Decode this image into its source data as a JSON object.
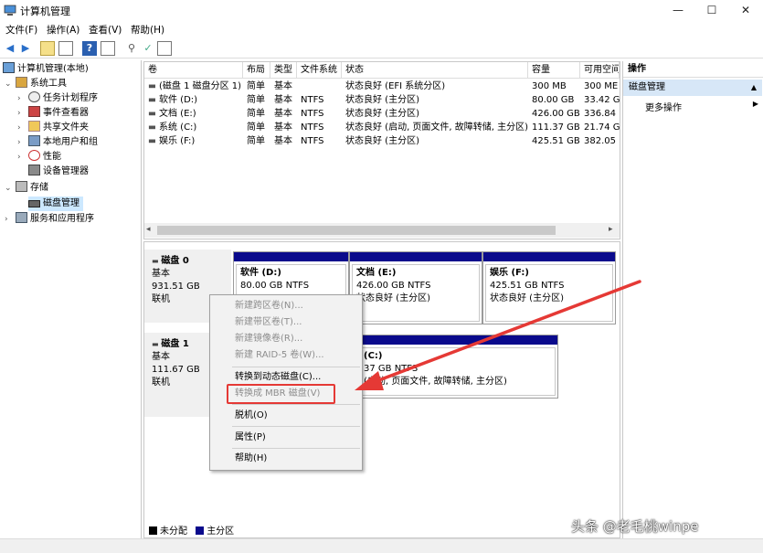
{
  "window": {
    "title": "计算机管理",
    "min": "—",
    "max": "☐",
    "close": "✕"
  },
  "menu": [
    "文件(F)",
    "操作(A)",
    "查看(V)",
    "帮助(H)"
  ],
  "tree": {
    "root": "计算机管理(本地)",
    "system_tools": "系统工具",
    "task_scheduler": "任务计划程序",
    "event_viewer": "事件查看器",
    "shared_folders": "共享文件夹",
    "local_users": "本地用户和组",
    "performance": "性能",
    "device_manager": "设备管理器",
    "storage": "存储",
    "disk_management": "磁盘管理",
    "services": "服务和应用程序"
  },
  "volumes": {
    "headers": [
      "卷",
      "布局",
      "类型",
      "文件系统",
      "状态",
      "容量",
      "可用空间"
    ],
    "rows": [
      [
        "(磁盘 1 磁盘分区 1)",
        "简单",
        "基本",
        "",
        "状态良好 (EFI 系统分区)",
        "300 MB",
        "300 ME"
      ],
      [
        "软件 (D:)",
        "简单",
        "基本",
        "NTFS",
        "状态良好 (主分区)",
        "80.00 GB",
        "33.42 G"
      ],
      [
        "文档 (E:)",
        "简单",
        "基本",
        "NTFS",
        "状态良好 (主分区)",
        "426.00 GB",
        "336.84"
      ],
      [
        "系统 (C:)",
        "简单",
        "基本",
        "NTFS",
        "状态良好 (启动, 页面文件, 故障转储, 主分区)",
        "111.37 GB",
        "21.74 G"
      ],
      [
        "娱乐 (F:)",
        "简单",
        "基本",
        "NTFS",
        "状态良好 (主分区)",
        "425.51 GB",
        "382.05"
      ]
    ]
  },
  "disks": {
    "disk0": {
      "name": "磁盘 0",
      "type": "基本",
      "size": "931.51 GB",
      "state": "联机"
    },
    "disk1": {
      "name": "磁盘 1",
      "type": "基本",
      "size": "111.67 GB",
      "state": "联机"
    },
    "d_name": "软件 (D:)",
    "d_size": "80.00 GB NTFS",
    "e_name": "文档 (E:)",
    "e_size": "426.00 GB NTFS",
    "e_state": "状态良好 (主分区)",
    "f_name": "娱乐 (F:)",
    "f_size": "425.51 GB NTFS",
    "f_state": "状态良好 (主分区)",
    "c_name": "(C:)",
    "c_size": "37 GB NTFS",
    "c_state": "(启动, 页面文件, 故障转储, 主分区)"
  },
  "context_menu": {
    "new_spanned": "新建跨区卷(N)...",
    "new_striped": "新建带区卷(T)...",
    "new_mirror": "新建镜像卷(R)...",
    "new_raid5": "新建 RAID-5 卷(W)...",
    "to_dynamic": "转换到动态磁盘(C)...",
    "to_mbr": "转换成 MBR 磁盘(V)",
    "offline": "脱机(O)",
    "properties": "属性(P)",
    "help": "帮助(H)"
  },
  "legend": {
    "unallocated": "未分配",
    "primary": "主分区",
    "unallocated_color": "#000000",
    "primary_color": "#0a0a8c"
  },
  "actions": {
    "header": "操作",
    "selected": "磁盘管理",
    "more": "更多操作"
  },
  "watermark": "头条 @老毛桃winpe",
  "colors": {
    "highlight_box": "#e53935",
    "arrow": "#e53935"
  }
}
